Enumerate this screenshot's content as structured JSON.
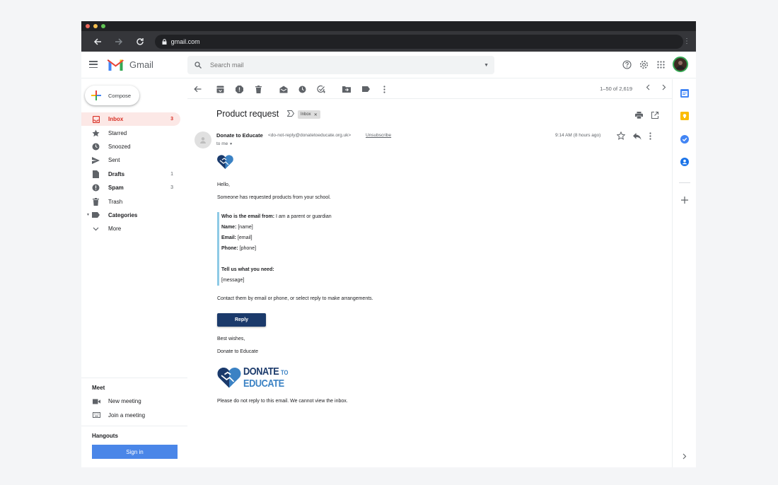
{
  "browser": {
    "url": "gmail.com"
  },
  "header": {
    "logo_text": "Gmail",
    "search_placeholder": "Search mail"
  },
  "sidebar": {
    "compose_label": "Compose",
    "items": [
      {
        "label": "Inbox",
        "count": "3",
        "icon": "inbox-icon"
      },
      {
        "label": "Starred",
        "count": "",
        "icon": "star-icon"
      },
      {
        "label": "Snoozed",
        "count": "",
        "icon": "clock-icon"
      },
      {
        "label": "Sent",
        "count": "",
        "icon": "send-icon"
      },
      {
        "label": "Drafts",
        "count": "1",
        "icon": "draft-icon"
      },
      {
        "label": "Spam",
        "count": "3",
        "icon": "spam-icon"
      },
      {
        "label": "Trash",
        "count": "",
        "icon": "trash-icon"
      },
      {
        "label": "Categories",
        "count": "",
        "icon": "label-icon"
      },
      {
        "label": "More",
        "count": "",
        "icon": "chevron-down-icon"
      }
    ],
    "meet": {
      "title": "Meet",
      "new_meeting": "New meeting",
      "join_meeting": "Join a meeting"
    },
    "hangouts": {
      "title": "Hangouts",
      "signin_label": "Sign in"
    }
  },
  "toolbar": {
    "pager_text": "1–50 of 2,619"
  },
  "message": {
    "subject": "Product request",
    "label_chip": "Inbox",
    "sender_name": "Donate to Educate",
    "sender_email": "<do-not-reply@donatetoeducate.org.uk>",
    "unsubscribe": "Unsubscribe",
    "to_line": "to me",
    "time": "9:14 AM (8 hours ago)",
    "body": {
      "greeting": "Hello,",
      "intro": "Someone has requested products from your school.",
      "from_label": "Who is the email from:",
      "from_value": " I am a parent or guardian",
      "name_label": "Name:",
      "name_value": " [name]",
      "email_label": "Email:",
      "email_value": " [email]",
      "phone_label": "Phone:",
      "phone_value": " [phone]",
      "need_label": "Tell us what you need:",
      "need_value": "[message]",
      "contact": "Contact them by email or phone, or select reply to make arrangements.",
      "reply_button": "Reply",
      "signoff": "Best wishes,",
      "signature": "Donate to Educate",
      "logo_word1": "DONATE",
      "logo_word2": "TO",
      "logo_word3": "EDUCATE",
      "footer": "Please do not reply to this email. We cannot view the inbox."
    }
  },
  "colors": {
    "accent_red": "#d93025",
    "brand_navy": "#1b3a6b",
    "brand_blue": "#3b82c4",
    "quote_bar": "#8ecae6",
    "signin_blue": "#4a86e8"
  }
}
